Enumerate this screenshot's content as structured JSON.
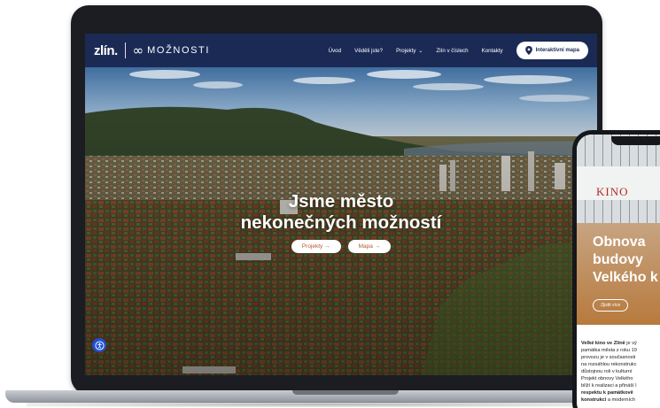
{
  "header": {
    "logo_zlin": "zlín.",
    "logo_infinity": "∞",
    "logo_text": "MOŽNOSTI",
    "nav": [
      {
        "label": "Úvod"
      },
      {
        "label": "Věděli jste?"
      },
      {
        "label": "Projekty"
      },
      {
        "label": "Zlín v číslech"
      },
      {
        "label": "Kontakty"
      }
    ],
    "map_button": "Interaktivní mapa"
  },
  "hero": {
    "title_line1": "Jsme město",
    "title_line2": "nekonečných možností",
    "buttons": [
      {
        "label": "Projekty →"
      },
      {
        "label": "Mapa →"
      }
    ]
  },
  "phone": {
    "sign": "KINO",
    "title": "Obnova budovy Velkého k",
    "button": "Zjistit více",
    "text_lines": [
      {
        "bold": "Velké kino ve Zlíně",
        "rest": " je vý"
      },
      {
        "bold": "",
        "rest": "památka města z roku 19"
      },
      {
        "bold": "",
        "rest": "provozu je v současnosti"
      },
      {
        "bold": "",
        "rest": "na rozsáhlou rekonstrukc"
      },
      {
        "bold": "",
        "rest": "důstojnou roli v kulturní"
      },
      {
        "bold": "",
        "rest": "Projekt obnovy Velkého"
      },
      {
        "bold": "",
        "rest": "blíží k realizaci a přináší l"
      },
      {
        "bold": "respektu k památkově",
        "rest": ""
      },
      {
        "bold": "konstrukci",
        "rest": " a moderních"
      }
    ]
  },
  "colors": {
    "header_bg": "#1b2a55",
    "accent_orange": "#b55a2a",
    "a11y_blue": "#1f4fd1"
  }
}
